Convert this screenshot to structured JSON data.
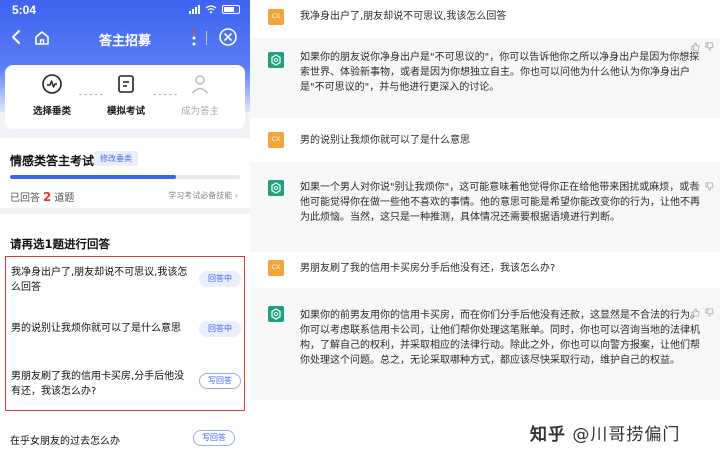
{
  "status_bar": {
    "time": "5:04"
  },
  "nav": {
    "title": "答主招募"
  },
  "steps": [
    {
      "label": "选择垂类",
      "icon": "chart-pulse-icon"
    },
    {
      "label": "模拟考试",
      "icon": "document-icon"
    },
    {
      "label": "成为答主",
      "icon": "person-icon"
    }
  ],
  "exam": {
    "title": "情感类答主考试",
    "tag": "修改垂类",
    "answered_prefix": "已回答",
    "answered_count": "2",
    "answered_suffix": "道题",
    "progress_fraction": 0.72,
    "note": "学习考试必备技能"
  },
  "questions": {
    "header": "请再选1题进行回答",
    "items": [
      {
        "text": "我净身出户了,朋友却说不可思议,我该怎么回答",
        "status": "回答中"
      },
      {
        "text": "男的说别让我烦你就可以了是什么意思",
        "status": "回答中"
      },
      {
        "text": "男朋友刷了我的信用卡买房,分手后他没有还，我该怎么办?",
        "status": "写回答"
      },
      {
        "text": "在乎女朋友的过去怎么办",
        "status": "写回答"
      }
    ]
  },
  "chat": {
    "user_avatar_text": "CX",
    "messages": [
      {
        "role": "user",
        "text": "我净身出户了,朋友却说不可思议,我该怎么回答"
      },
      {
        "role": "bot",
        "text": "如果你的朋友说你净身出户是\"不可思议的\"，你可以告诉他你之所以净身出户是因为你想探索世界、体验新事物，或者是因为你想独立自主。你也可以问他为什么他认为你净身出户是\"不可思议的\"，并与他进行更深入的讨论。"
      },
      {
        "role": "user",
        "text": "男的说别让我烦你就可以了是什么意思"
      },
      {
        "role": "bot",
        "text": "如果一个男人对你说\"别让我烦你\"，这可能意味着他觉得你正在给他带来困扰或麻烦，或者他可能觉得你在做一些他不喜欢的事情。他的意思可能是希望你能改变你的行为，让他不再为此烦恼。当然，这只是一种推测，具体情况还需要根据语境进行判断。"
      },
      {
        "role": "user",
        "text": "男朋友刷了我的信用卡买房分手后他没有还，我该怎么办?"
      },
      {
        "role": "bot",
        "text": "如果你的前男友用你的信用卡买房，而在你们分手后他没有还款，这显然是不合法的行为。你可以考虑联系信用卡公司，让他们帮你处理这笔账单。同时，你也可以咨询当地的法律机构，了解自己的权利，并采取相应的法律行动。除此之外，你也可以向警方报案，让他们帮你处理这个问题。总之，无论采取哪种方式，都应该尽快采取行动，维护自己的权益。"
      }
    ]
  },
  "watermark": {
    "site": "知乎",
    "author": "@川哥捞偏门"
  },
  "colors": {
    "brand_blue": "#3d63f0",
    "bot_green": "#19a37f",
    "highlight_red": "#d83a34",
    "user_avatar": "#f0a43a"
  }
}
